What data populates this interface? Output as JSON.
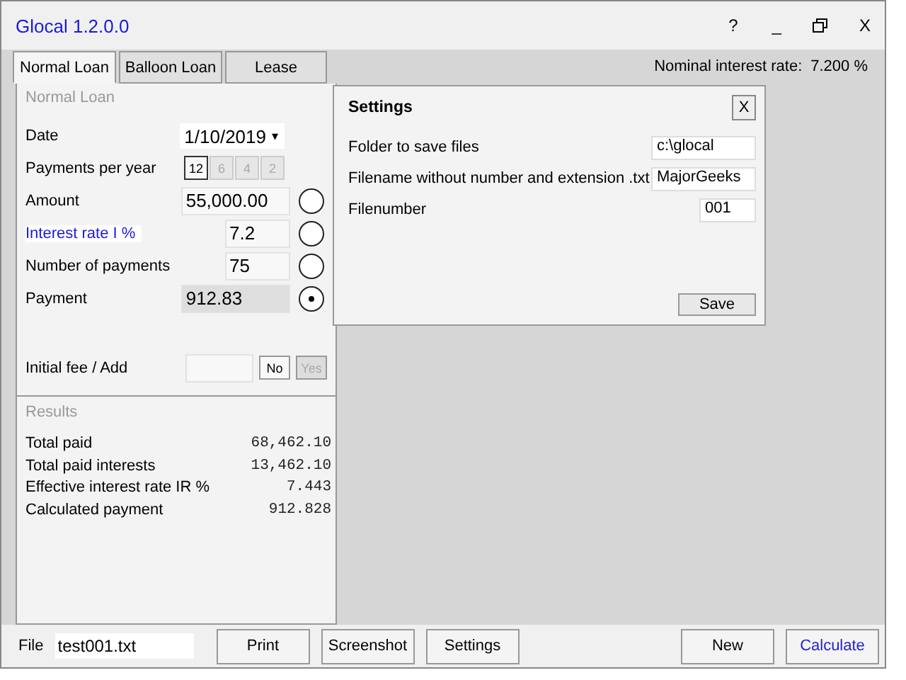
{
  "window": {
    "title": "Glocal 1.2.0.0",
    "help": "?",
    "minimize": "_",
    "close": "X"
  },
  "tabs": [
    {
      "label": "Normal Loan",
      "selected": true
    },
    {
      "label": "Balloon Loan",
      "selected": false
    },
    {
      "label": "Lease",
      "selected": false
    }
  ],
  "nominal_rate": {
    "label": "Nominal interest rate:",
    "value": "7.200 %"
  },
  "loan_panel": {
    "heading": "Normal Loan",
    "date": {
      "label": "Date",
      "value": "1/10/2019",
      "caret": "▾"
    },
    "payments_per_year": {
      "label": "Payments per year",
      "options": [
        {
          "label": "12",
          "selected": true
        },
        {
          "label": "6",
          "selected": false
        },
        {
          "label": "4",
          "selected": false
        },
        {
          "label": "2",
          "selected": false
        }
      ]
    },
    "fields": [
      {
        "label": "Amount",
        "value": "55,000.00",
        "selected": false,
        "highlighted": false,
        "readonly": false
      },
      {
        "label": "Interest rate I  %",
        "value": "7.2",
        "selected": false,
        "highlighted": true,
        "readonly": false
      },
      {
        "label": "Number of payments",
        "value": "75",
        "selected": false,
        "highlighted": false,
        "readonly": false
      },
      {
        "label": "Payment",
        "value": "912.83",
        "selected": true,
        "highlighted": false,
        "readonly": true
      }
    ],
    "initial_fee": {
      "label": "Initial fee / Add",
      "buttons": [
        {
          "label": "No",
          "disabled": false
        },
        {
          "label": "Yes",
          "disabled": true
        }
      ]
    }
  },
  "results": {
    "heading": "Results",
    "rows": [
      {
        "label": "Total paid",
        "value": "68,462.10"
      },
      {
        "label": "Total paid interests",
        "value": "13,462.10"
      },
      {
        "label": "Effective interest rate IR %",
        "value": "7.443"
      },
      {
        "label": "Calculated payment",
        "value": "912.828"
      }
    ]
  },
  "settings_dialog": {
    "title": "Settings",
    "close": "X",
    "fields": [
      {
        "label": "Folder to save files",
        "value": "c:\\glocal",
        "wide": true
      },
      {
        "label": "Filename without number and extension .txt",
        "value": "MajorGeeks",
        "wide": true
      },
      {
        "label": "Filenumber",
        "value": "001",
        "wide": false
      }
    ],
    "save": "Save"
  },
  "bottom_bar": {
    "file_label": "File",
    "file_value": "test001.txt",
    "left_buttons": [
      {
        "label": "Print",
        "primary": false
      },
      {
        "label": "Screenshot",
        "primary": false
      },
      {
        "label": "Settings",
        "primary": false
      }
    ],
    "right_buttons": [
      {
        "label": "New",
        "primary": false
      },
      {
        "label": "Calculate",
        "primary": true
      }
    ]
  }
}
